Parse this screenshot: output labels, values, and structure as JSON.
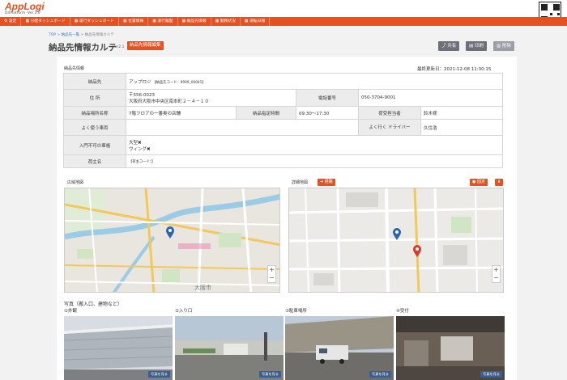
{
  "app": {
    "logo": "AppLogi",
    "platform": "D4Platform -Ver.3.0"
  },
  "nav": [
    {
      "icon": "gear-icon",
      "glyph": "⚙",
      "label": "設定"
    },
    {
      "icon": "grid-icon",
      "glyph": "▦",
      "label": "分配ダッシュボード"
    },
    {
      "icon": "grid-icon",
      "glyph": "▦",
      "label": "運行ダッシュボード"
    },
    {
      "icon": "grid-icon",
      "glyph": "▦",
      "label": "位置情報"
    },
    {
      "icon": "grid-icon",
      "glyph": "▦",
      "label": "運行履歴"
    },
    {
      "icon": "grid-icon",
      "glyph": "▦",
      "label": "納品先情報"
    },
    {
      "icon": "grid-icon",
      "glyph": "▦",
      "label": "勤務状況"
    },
    {
      "icon": "grid-icon",
      "glyph": "▦",
      "label": "運転日報"
    }
  ],
  "breadcrumb": {
    "top": "TOP",
    "list": "納品先一覧",
    "current": "納品先情報カルテ"
  },
  "page": {
    "title": "納品先情報カルテ",
    "version": "Ver2.1",
    "edit_label": "納品先情報編集"
  },
  "toolbar": {
    "share": "共有",
    "print": "印刷",
    "delete": "削除"
  },
  "info": {
    "section_label": "納品先情報",
    "updated": "最終更新日：2021-12-08 11:30:15",
    "customer_label": "納品先",
    "customer_name": "アップロジ",
    "customer_code": "【納品先コード：9999_00001】",
    "address_label": "住 所",
    "postal": "〒556-0023",
    "address": "大阪府大阪市中央区南本町２－４－１０",
    "phone_label": "電話番号",
    "phone": "050-3704-9001",
    "location_label": "納品場所名称",
    "location": "7階フロアの一番奥の店舗",
    "time_label": "納品指定時間",
    "time": "09:30～17:30",
    "person_label": "荷受担当者",
    "person": "鈴木様",
    "vehicle_label": "よく使う車両",
    "driver_label": "よく行く ドライバー",
    "driver": "久住浩",
    "restrict_label": "入門不可の車格",
    "restrict1": "大型✖",
    "restrict2": "ウィング✖",
    "shipper_label": "荷主名",
    "shipper_code": "【荷主コード：】"
  },
  "maps": {
    "wide_label": "広域地図",
    "detail_label": "詳細地図",
    "detail_btn": "経路",
    "fix_btn": "固定",
    "zoom_in": "+",
    "zoom_out": "−",
    "place1": "大阪市"
  },
  "photos": {
    "section_label": "写真（搬入口、建物など）",
    "items": [
      {
        "label": "①外観",
        "btn": "写真を見る"
      },
      {
        "label": "②入り口",
        "btn": "写真を見る"
      },
      {
        "label": "③駐車場所",
        "btn": "写真を見る"
      },
      {
        "label": "④受付",
        "btn": "写真を見る"
      }
    ]
  },
  "colors": {
    "accent": "#e8501e",
    "pin_blue": "#2a64b3",
    "pin_red": "#d63a2c"
  }
}
